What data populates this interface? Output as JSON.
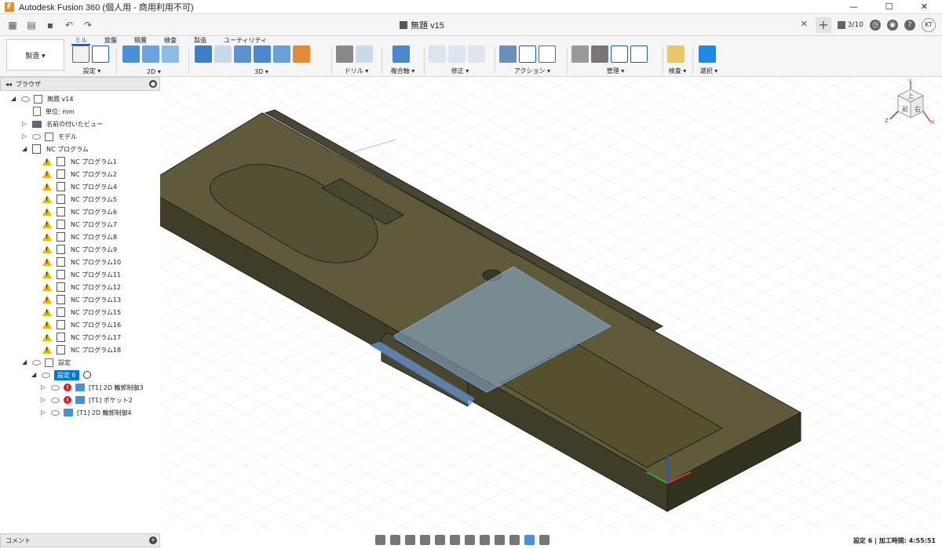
{
  "window": {
    "title": "Autodesk Fusion 360 (個人用 - 商用利用不可)",
    "buttons": [
      "—",
      "☐",
      "✕"
    ]
  },
  "document": {
    "tab_title": "無題 v15",
    "jobs": "3/10",
    "user_initials": "KT"
  },
  "toolbar": {
    "workspace": "製造 ▾",
    "tabs": [
      "ミル",
      "旋盤",
      "積層",
      "検査",
      "製造",
      "ユーティリティ"
    ],
    "active_tab": "ミル",
    "groups": [
      {
        "label": "設定 ▾"
      },
      {
        "label": "2D ▾"
      },
      {
        "label": "3D ▾"
      },
      {
        "label": "ドリル ▾"
      },
      {
        "label": "複合軸 ▾"
      },
      {
        "label": "修正 ▾"
      },
      {
        "label": "アクション ▾"
      },
      {
        "label": "管理 ▾"
      },
      {
        "label": "検査 ▾"
      },
      {
        "label": "選択 ▾"
      }
    ]
  },
  "browser": {
    "title": "ブラウザ",
    "root": "無題 v14",
    "units": "単位: mm",
    "named_views": "名前の付いたビュー",
    "model": "モデル",
    "nc_programs": "NC プログラム",
    "nc_items": [
      "NC プログラム1",
      "NC プログラム2",
      "NC プログラム4",
      "NC プログラム5",
      "NC プログラム6",
      "NC プログラム7",
      "NC プログラム8",
      "NC プログラム9",
      "NC プログラム10",
      "NC プログラム11",
      "NC プログラム12",
      "NC プログラム13",
      "NC プログラム15",
      "NC プログラム16",
      "NC プログラム17",
      "NC プログラム18"
    ],
    "setups": "設定",
    "setup6": "設定 6",
    "operations": [
      "[T1] 2D 輪郭制御3",
      "[T1] ポケット2",
      "[T1] 2D 輪郭制御4"
    ]
  },
  "viewcube": {
    "top": "上",
    "front": "前",
    "right": "右",
    "axis_x": "X",
    "axis_y": "Y",
    "axis_z": "Z"
  },
  "comments": {
    "title": "コメント"
  },
  "status": {
    "text": "設定 6 | 加工時間: 4:55:51"
  },
  "colors": {
    "model_top": "#5e5a3a",
    "model_front": "#4a4730",
    "model_side": "#3c3a27",
    "selection": "#8fb2d8",
    "accent": "#0078d4"
  }
}
